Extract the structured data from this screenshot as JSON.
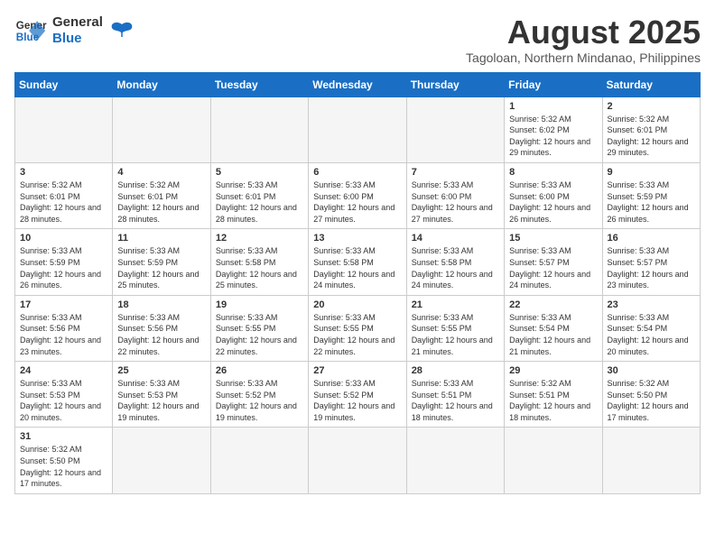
{
  "header": {
    "logo_general": "General",
    "logo_blue": "Blue",
    "month_year": "August 2025",
    "location": "Tagoloan, Northern Mindanao, Philippines"
  },
  "days_of_week": [
    "Sunday",
    "Monday",
    "Tuesday",
    "Wednesday",
    "Thursday",
    "Friday",
    "Saturday"
  ],
  "weeks": [
    [
      {
        "day": "",
        "info": ""
      },
      {
        "day": "",
        "info": ""
      },
      {
        "day": "",
        "info": ""
      },
      {
        "day": "",
        "info": ""
      },
      {
        "day": "",
        "info": ""
      },
      {
        "day": "1",
        "info": "Sunrise: 5:32 AM\nSunset: 6:02 PM\nDaylight: 12 hours and 29 minutes."
      },
      {
        "day": "2",
        "info": "Sunrise: 5:32 AM\nSunset: 6:01 PM\nDaylight: 12 hours and 29 minutes."
      }
    ],
    [
      {
        "day": "3",
        "info": "Sunrise: 5:32 AM\nSunset: 6:01 PM\nDaylight: 12 hours and 28 minutes."
      },
      {
        "day": "4",
        "info": "Sunrise: 5:32 AM\nSunset: 6:01 PM\nDaylight: 12 hours and 28 minutes."
      },
      {
        "day": "5",
        "info": "Sunrise: 5:33 AM\nSunset: 6:01 PM\nDaylight: 12 hours and 28 minutes."
      },
      {
        "day": "6",
        "info": "Sunrise: 5:33 AM\nSunset: 6:00 PM\nDaylight: 12 hours and 27 minutes."
      },
      {
        "day": "7",
        "info": "Sunrise: 5:33 AM\nSunset: 6:00 PM\nDaylight: 12 hours and 27 minutes."
      },
      {
        "day": "8",
        "info": "Sunrise: 5:33 AM\nSunset: 6:00 PM\nDaylight: 12 hours and 26 minutes."
      },
      {
        "day": "9",
        "info": "Sunrise: 5:33 AM\nSunset: 5:59 PM\nDaylight: 12 hours and 26 minutes."
      }
    ],
    [
      {
        "day": "10",
        "info": "Sunrise: 5:33 AM\nSunset: 5:59 PM\nDaylight: 12 hours and 26 minutes."
      },
      {
        "day": "11",
        "info": "Sunrise: 5:33 AM\nSunset: 5:59 PM\nDaylight: 12 hours and 25 minutes."
      },
      {
        "day": "12",
        "info": "Sunrise: 5:33 AM\nSunset: 5:58 PM\nDaylight: 12 hours and 25 minutes."
      },
      {
        "day": "13",
        "info": "Sunrise: 5:33 AM\nSunset: 5:58 PM\nDaylight: 12 hours and 24 minutes."
      },
      {
        "day": "14",
        "info": "Sunrise: 5:33 AM\nSunset: 5:58 PM\nDaylight: 12 hours and 24 minutes."
      },
      {
        "day": "15",
        "info": "Sunrise: 5:33 AM\nSunset: 5:57 PM\nDaylight: 12 hours and 24 minutes."
      },
      {
        "day": "16",
        "info": "Sunrise: 5:33 AM\nSunset: 5:57 PM\nDaylight: 12 hours and 23 minutes."
      }
    ],
    [
      {
        "day": "17",
        "info": "Sunrise: 5:33 AM\nSunset: 5:56 PM\nDaylight: 12 hours and 23 minutes."
      },
      {
        "day": "18",
        "info": "Sunrise: 5:33 AM\nSunset: 5:56 PM\nDaylight: 12 hours and 22 minutes."
      },
      {
        "day": "19",
        "info": "Sunrise: 5:33 AM\nSunset: 5:55 PM\nDaylight: 12 hours and 22 minutes."
      },
      {
        "day": "20",
        "info": "Sunrise: 5:33 AM\nSunset: 5:55 PM\nDaylight: 12 hours and 22 minutes."
      },
      {
        "day": "21",
        "info": "Sunrise: 5:33 AM\nSunset: 5:55 PM\nDaylight: 12 hours and 21 minutes."
      },
      {
        "day": "22",
        "info": "Sunrise: 5:33 AM\nSunset: 5:54 PM\nDaylight: 12 hours and 21 minutes."
      },
      {
        "day": "23",
        "info": "Sunrise: 5:33 AM\nSunset: 5:54 PM\nDaylight: 12 hours and 20 minutes."
      }
    ],
    [
      {
        "day": "24",
        "info": "Sunrise: 5:33 AM\nSunset: 5:53 PM\nDaylight: 12 hours and 20 minutes."
      },
      {
        "day": "25",
        "info": "Sunrise: 5:33 AM\nSunset: 5:53 PM\nDaylight: 12 hours and 19 minutes."
      },
      {
        "day": "26",
        "info": "Sunrise: 5:33 AM\nSunset: 5:52 PM\nDaylight: 12 hours and 19 minutes."
      },
      {
        "day": "27",
        "info": "Sunrise: 5:33 AM\nSunset: 5:52 PM\nDaylight: 12 hours and 19 minutes."
      },
      {
        "day": "28",
        "info": "Sunrise: 5:33 AM\nSunset: 5:51 PM\nDaylight: 12 hours and 18 minutes."
      },
      {
        "day": "29",
        "info": "Sunrise: 5:32 AM\nSunset: 5:51 PM\nDaylight: 12 hours and 18 minutes."
      },
      {
        "day": "30",
        "info": "Sunrise: 5:32 AM\nSunset: 5:50 PM\nDaylight: 12 hours and 17 minutes."
      }
    ],
    [
      {
        "day": "31",
        "info": "Sunrise: 5:32 AM\nSunset: 5:50 PM\nDaylight: 12 hours and 17 minutes."
      },
      {
        "day": "",
        "info": ""
      },
      {
        "day": "",
        "info": ""
      },
      {
        "day": "",
        "info": ""
      },
      {
        "day": "",
        "info": ""
      },
      {
        "day": "",
        "info": ""
      },
      {
        "day": "",
        "info": ""
      }
    ]
  ]
}
